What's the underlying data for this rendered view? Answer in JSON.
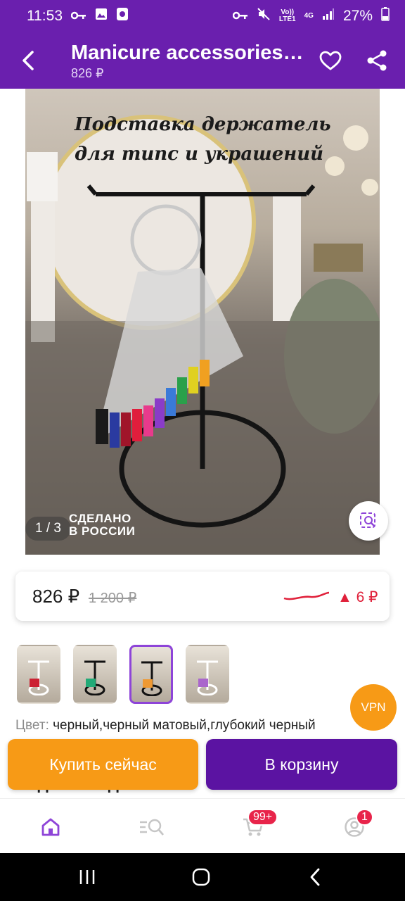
{
  "status_bar": {
    "time": "11:53",
    "volte": "Vo))",
    "lte": "LTE1",
    "network": "4G",
    "battery": "27%"
  },
  "app_bar": {
    "title": "Manicure accessories…",
    "subtitle": "826 ₽"
  },
  "product_image": {
    "caption_line1": "Подставка держатель",
    "caption_line2": "для типс и украшений",
    "counter": "1 / 3",
    "made_badge_line1": "СДЕЛАНО",
    "made_badge_line2": "В РОССИИ"
  },
  "price": {
    "current": "826 ₽",
    "old": "1 200 ₽",
    "delta": "▲ 6 ₽",
    "trend_color": "#e0203a"
  },
  "thumbnails": [
    {
      "active": false
    },
    {
      "active": false
    },
    {
      "active": true
    },
    {
      "active": false
    }
  ],
  "vpn": {
    "label": "VPN"
  },
  "color": {
    "label": "Цвет:",
    "value": "черный,черный матовый,глубокий черный"
  },
  "partial_title": "Подставка для типс",
  "actions": {
    "buy_now": "Купить сейчас",
    "add_to_cart": "В корзину"
  },
  "bottom_nav": {
    "cart_badge": "99+",
    "profile_badge": "1"
  },
  "colors": {
    "brand_purple": "#6a1fae",
    "cart_purple": "#5b13a2",
    "orange": "#f79a16",
    "badge_red": "#e8244a"
  }
}
